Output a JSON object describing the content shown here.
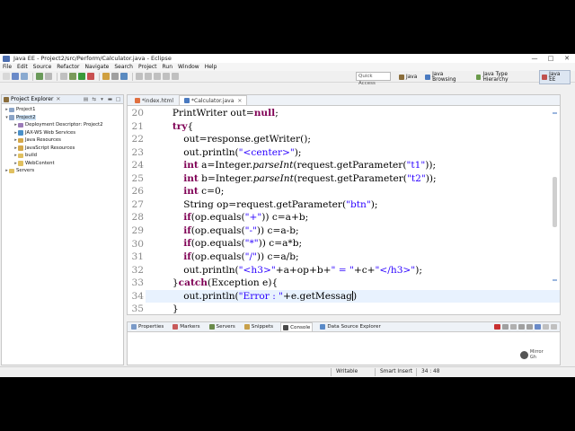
{
  "window": {
    "title": "Java EE - Project2/src/Perform/Calculator.java - Eclipse",
    "controls": [
      "—",
      "□",
      "✕"
    ]
  },
  "menu": [
    "File",
    "Edit",
    "Source",
    "Refactor",
    "Navigate",
    "Search",
    "Project",
    "Run",
    "Window",
    "Help"
  ],
  "toolbar": {
    "quick_access_placeholder": "Quick Access",
    "perspectives": [
      {
        "label": "Java",
        "icon": "java-perspective-icon",
        "color": "#8a6d3b"
      },
      {
        "label": "Java Browsing",
        "icon": "java-browsing-icon",
        "color": "#4a7ac0"
      },
      {
        "label": "Java Type Hierarchy",
        "icon": "type-hierarchy-icon",
        "color": "#6a9a4a"
      },
      {
        "label": "Java EE",
        "icon": "java-ee-icon",
        "color": "#c0504d",
        "active": true
      }
    ]
  },
  "explorer": {
    "title": "Project Explorer",
    "items": [
      {
        "label": "Project1",
        "level": 0,
        "arrow": "▸",
        "icon": "project-folder-icon",
        "color": "#8aa4c8"
      },
      {
        "label": "Project2",
        "level": 0,
        "arrow": "▾",
        "icon": "project-folder-icon",
        "color": "#8aa4c8",
        "selected": true
      },
      {
        "label": "Deployment Descriptor: Project2",
        "level": 1,
        "arrow": "▸",
        "icon": "deployment-descriptor-icon",
        "color": "#9b7bb8"
      },
      {
        "label": "JAX-WS Web Services",
        "level": 1,
        "arrow": "▸",
        "icon": "web-services-icon",
        "color": "#4a90c8"
      },
      {
        "label": "Java Resources",
        "level": 1,
        "arrow": "▸",
        "icon": "java-resources-icon",
        "color": "#d4a84a"
      },
      {
        "label": "JavaScript Resources",
        "level": 1,
        "arrow": "▸",
        "icon": "javascript-resources-icon",
        "color": "#d4a84a"
      },
      {
        "label": "build",
        "level": 1,
        "arrow": "▸",
        "icon": "folder-icon",
        "color": "#e0c060"
      },
      {
        "label": "WebContent",
        "level": 1,
        "arrow": "▸",
        "icon": "folder-icon",
        "color": "#e0c060"
      },
      {
        "label": "Servers",
        "level": 0,
        "arrow": "▸",
        "icon": "servers-folder-icon",
        "color": "#e0c060"
      }
    ]
  },
  "editor": {
    "tabs": [
      {
        "label": "*index.html",
        "icon": "html-file-icon",
        "color": "#e07040"
      },
      {
        "label": "*Calculator.java",
        "icon": "java-file-icon",
        "color": "#4a7ac0",
        "active": true
      }
    ],
    "lines": [
      {
        "num": "20",
        "indent": 3,
        "tokens": [
          [
            "PrintWriter out=",
            ""
          ],
          [
            "null",
            "kw"
          ],
          [
            ";",
            ""
          ]
        ]
      },
      {
        "num": "21",
        "indent": 3,
        "tokens": [
          [
            "try",
            "kw"
          ],
          [
            "{",
            ""
          ]
        ]
      },
      {
        "num": "22",
        "indent": 4,
        "tokens": [
          [
            "out=response.getWriter();",
            ""
          ]
        ]
      },
      {
        "num": "23",
        "indent": 4,
        "tokens": [
          [
            "out.println(",
            ""
          ],
          [
            "\"<center>\"",
            "str"
          ],
          [
            ");",
            ""
          ]
        ]
      },
      {
        "num": "24",
        "indent": 4,
        "tokens": [
          [
            "int",
            "kw"
          ],
          [
            " a=Integer.",
            ""
          ],
          [
            "parseInt",
            "it"
          ],
          [
            "(request.getParameter(",
            ""
          ],
          [
            "\"t1\"",
            "str"
          ],
          [
            "));",
            ""
          ]
        ]
      },
      {
        "num": "25",
        "indent": 4,
        "tokens": [
          [
            "int",
            "kw"
          ],
          [
            " b=Integer.",
            ""
          ],
          [
            "parseInt",
            "it"
          ],
          [
            "(request.getParameter(",
            ""
          ],
          [
            "\"t2\"",
            "str"
          ],
          [
            "));",
            ""
          ]
        ]
      },
      {
        "num": "26",
        "indent": 4,
        "tokens": [
          [
            "int",
            "kw"
          ],
          [
            " c=0;",
            ""
          ]
        ]
      },
      {
        "num": "27",
        "indent": 4,
        "tokens": [
          [
            "String op=request.getParameter(",
            ""
          ],
          [
            "\"btn\"",
            "str"
          ],
          [
            ");",
            ""
          ]
        ]
      },
      {
        "num": "28",
        "indent": 4,
        "tokens": [
          [
            "if",
            "kw"
          ],
          [
            "(op.equals(",
            ""
          ],
          [
            "\"+\"",
            "str"
          ],
          [
            ")) c=a+b;",
            ""
          ]
        ]
      },
      {
        "num": "29",
        "indent": 4,
        "tokens": [
          [
            "if",
            "kw"
          ],
          [
            "(op.equals(",
            ""
          ],
          [
            "\"-\"",
            "str"
          ],
          [
            ")) c=a-b;",
            ""
          ]
        ]
      },
      {
        "num": "30",
        "indent": 4,
        "tokens": [
          [
            "if",
            "kw"
          ],
          [
            "(op.equals(",
            ""
          ],
          [
            "\"*\"",
            "str"
          ],
          [
            ")) c=a*b;",
            ""
          ]
        ]
      },
      {
        "num": "31",
        "indent": 4,
        "tokens": [
          [
            "if",
            "kw"
          ],
          [
            "(op.equals(",
            ""
          ],
          [
            "\"/\"",
            "str"
          ],
          [
            ")) c=a/b;",
            ""
          ]
        ]
      },
      {
        "num": "32",
        "indent": 4,
        "tokens": [
          [
            "out.println(",
            ""
          ],
          [
            "\"<h3>\"",
            "str"
          ],
          [
            "+a+op+b+",
            ""
          ],
          [
            "\" = \"",
            "str"
          ],
          [
            "+c+",
            ""
          ],
          [
            "\"</h3>\"",
            "str"
          ],
          [
            ");",
            ""
          ]
        ]
      },
      {
        "num": "33",
        "indent": 3,
        "tokens": [
          [
            "}",
            ""
          ],
          [
            "catch",
            "kw"
          ],
          [
            "(Exception e){",
            ""
          ]
        ]
      },
      {
        "num": "34",
        "indent": 4,
        "tokens": [
          [
            "out.println(",
            ""
          ],
          [
            "\"Error : \"",
            "str"
          ],
          [
            "+e.getMessag",
            ""
          ],
          [
            "",
            "caret"
          ],
          [
            ")",
            ""
          ]
        ],
        "current": true
      },
      {
        "num": "35",
        "indent": 3,
        "tokens": [
          [
            "}",
            ""
          ]
        ]
      }
    ]
  },
  "bottom": {
    "tabs": [
      {
        "label": "Properties",
        "icon": "properties-icon",
        "color": "#7a9ac8"
      },
      {
        "label": "Markers",
        "icon": "markers-icon",
        "color": "#c85a5a"
      },
      {
        "label": "Servers",
        "icon": "servers-icon",
        "color": "#6a8a4a"
      },
      {
        "label": "Snippets",
        "icon": "snippets-icon",
        "color": "#c8a04a"
      },
      {
        "label": "Console",
        "icon": "console-icon",
        "color": "#4a4a4a",
        "active": true
      },
      {
        "label": "Data Source Explorer",
        "icon": "data-source-icon",
        "color": "#5a8ac8"
      }
    ],
    "logo_text": "Mirror Gh"
  },
  "status": {
    "mode": "Writable",
    "insert": "Smart Insert",
    "position": "34 : 48"
  }
}
